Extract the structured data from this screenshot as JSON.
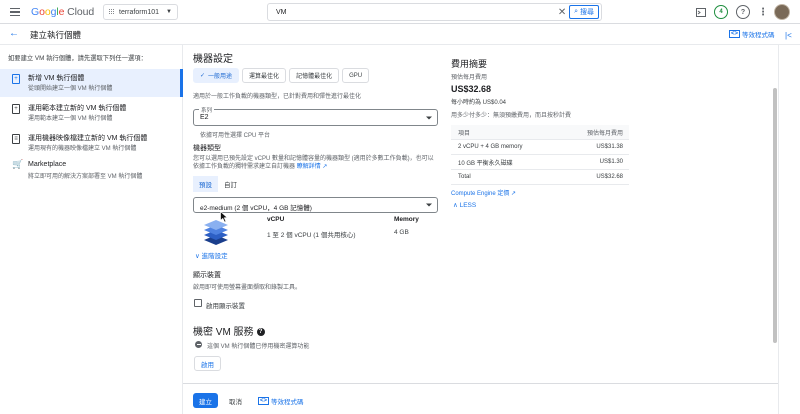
{
  "topbar": {
    "logo_parts": [
      "G",
      "o",
      "o",
      "g",
      "l",
      "e"
    ],
    "logo_cloud": "Cloud",
    "project": "terraform101",
    "search_value": "VM",
    "search_button": "搜尋",
    "notification_count": "4"
  },
  "header": {
    "title": "建立執行個體",
    "equivalent_code": "等效程式碼"
  },
  "sidebar": {
    "intro": "如要建立 VM 執行個體，請先選取下列任一選項：",
    "items": [
      {
        "title": "新增 VM 執行個體",
        "subtitle": "從頭開始建立一個 VM 執行個體",
        "icon": "plus-icon"
      },
      {
        "title": "運用範本建立新的 VM 執行個體",
        "subtitle": "運用範本建立一個 VM 執行個體",
        "icon": "template-icon"
      },
      {
        "title": "運用機器映像檔建立新的 VM 執行個體",
        "subtitle": "運用現有的機器映像檔建立 VM 執行個體",
        "icon": "machine-image-icon"
      },
      {
        "title": "Marketplace",
        "subtitle": "將立即可用的解決方案部署至 VM 執行個體",
        "icon": "marketplace-icon"
      }
    ]
  },
  "machine_config": {
    "title": "機器設定",
    "tabs": [
      "一般用途",
      "運算最佳化",
      "記憶體最佳化",
      "GPU"
    ],
    "tab_description": "適用於一般工作負載的機器類型，已針對費用和彈性進行最佳化",
    "series_label": "系列",
    "series_value": "E2",
    "series_help": "依據可用性選擇 CPU 平台",
    "machine_type_title": "機器類型",
    "machine_type_desc": "您可以選用已預先設定 vCPU 數量和記憶體容量的機器類型 (適用於多數工作負載)，也可以依據工作負載的獨特需求建立自訂機器",
    "machine_type_link": "瞭解詳情",
    "mode_tabs": [
      "預設",
      "自訂"
    ],
    "machine_type_value": "e2-medium (2 個 vCPU，4 GB 記憶體)",
    "vcpu_header": "vCPU",
    "vcpu_value": "1 至 2 個 vCPU (1 個共用核心)",
    "memory_header": "Memory",
    "memory_value": "4 GB",
    "advanced": "進階設定"
  },
  "display_device": {
    "title": "顯示裝置",
    "desc": "啟用即可使用螢幕畫面擷取和錄製工具。",
    "checkbox_label": "啟用顯示裝置"
  },
  "confidential": {
    "title": "機密 VM 服務",
    "status": "這個 VM 執行個體已停用機密運算功能",
    "enable_button": "啟用"
  },
  "cost": {
    "title": "費用摘要",
    "monthly_label": "預估每月費用",
    "monthly_value": "US$32.68",
    "hourly": "每小時約為 US$0.04",
    "note": "用多少付多少：無須預繳費用，而且按秒計費",
    "table_headers": [
      "項目",
      "預估每月費用"
    ],
    "rows": [
      [
        "2 vCPU + 4 GB memory",
        "US$31.38"
      ],
      [
        "10 GB 平衡永久磁碟",
        "US$1.30"
      ],
      [
        "Total",
        "US$32.68"
      ]
    ],
    "pricing_link": "Compute Engine 定價",
    "less": "LESS"
  },
  "actions": {
    "create": "建立",
    "cancel": "取消",
    "equivalent_code": "等效程式碼"
  }
}
